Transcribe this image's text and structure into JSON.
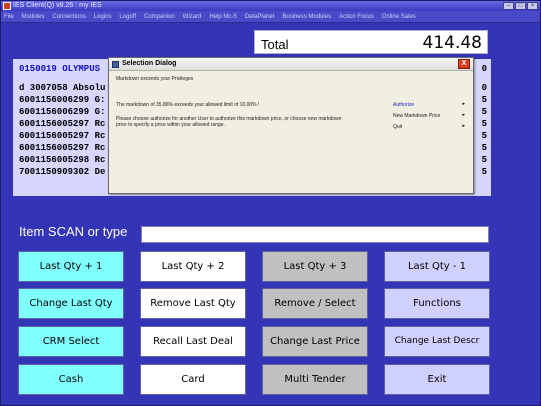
{
  "window": {
    "title": "IES Client(Q) v8.26 : my IES",
    "menu": [
      "File",
      "Modules",
      "Connections",
      "Logins",
      "Logoff",
      "Companion",
      "Wizard",
      "Help Mc-5",
      "DataPlanet",
      "Business Modules",
      "Action Focus",
      "Online Sales"
    ]
  },
  "total": {
    "label": "Total",
    "value": "414.48"
  },
  "receipt": {
    "customer": "0150019 OLYMPUS",
    "customer_right": "0",
    "lines": [
      {
        "text": "d 3007058 Absolu",
        "right": "0"
      },
      {
        "text": "6001156006299 G:",
        "right": "5"
      },
      {
        "text": "6001156006299 G:",
        "right": "5"
      },
      {
        "text": "6001156005297 Rc",
        "right": "5"
      },
      {
        "text": "6001156005297 Rc",
        "right": "5"
      },
      {
        "text": "6001156005297 Rc",
        "right": "5"
      },
      {
        "text": "6001156005298 Rc",
        "right": "5"
      },
      {
        "text": "7001150909302 De",
        "right": "5"
      }
    ]
  },
  "dialog": {
    "title": "Selection Dialog",
    "close_label": "X",
    "message1": "Markdown exceeds your Privileges",
    "message2": "The markdown of 35.86% exceeds your allowed limit of 10.00% !",
    "message3": "Please choose authorize for another User to authorize this markdown price, or choose new markdown price to specify a price within your allowed range.",
    "options": [
      {
        "label": "Authorize",
        "arrow": "▸"
      },
      {
        "label": "New Markdown Price",
        "arrow": "▸"
      },
      {
        "label": "Quit",
        "arrow": "▸"
      }
    ]
  },
  "scan": {
    "label": "Item SCAN or type",
    "value": ""
  },
  "buttons": {
    "row1": [
      "Last Qty + 1",
      "Last Qty + 2",
      "Last Qty + 3",
      "Last Qty - 1"
    ],
    "row2": [
      "Change Last Qty",
      "Remove Last Qty",
      "Remove / Select",
      "Functions"
    ],
    "row3": [
      "CRM Select",
      "Recall Last Deal",
      "Change Last Price",
      "Change Last Descr"
    ],
    "row4": [
      "Cash",
      "Card",
      "Multi Tender",
      "Exit"
    ]
  },
  "colors": {
    "background": "#3434b6",
    "receipt_bg": "#d6d6ff",
    "button_cyan": "#80ffff",
    "button_white": "#ffffff",
    "button_gray": "#c0c0c0",
    "button_lavender": "#d0d0ff"
  }
}
